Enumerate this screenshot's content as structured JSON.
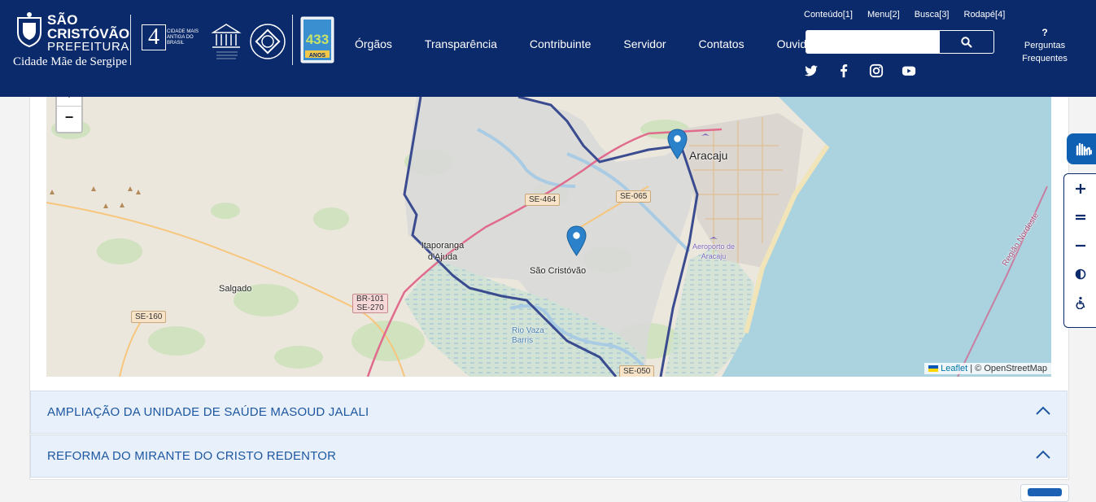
{
  "header": {
    "logo": {
      "line1": "SÃO",
      "line2": "CRISTÓVÃO",
      "line3": "PREFEITURA",
      "tagline": "Cidade Mãe de Sergipe"
    },
    "badge": {
      "number": "4",
      "text": "CIDADE MAIS ANTIGA DO BRASIL"
    },
    "anniversary": {
      "number": "433",
      "unit": "ANOS"
    },
    "nav": [
      "Órgãos",
      "Transparência",
      "Contribuinte",
      "Servidor",
      "Contatos",
      "Ouvidoria"
    ],
    "access_links": [
      "Conteúdo[1]",
      "Menu[2]",
      "Busca[3]",
      "Rodapé[4]"
    ],
    "search": {
      "placeholder": "",
      "value": ""
    },
    "social": [
      "twitter-icon",
      "facebook-icon",
      "instagram-icon",
      "youtube-icon"
    ],
    "faq": {
      "icon": "?",
      "line1": "Perguntas",
      "line2": "Frequentes"
    },
    "colors": {
      "bg": "#0b2a6b",
      "accent": "#1d57a0"
    }
  },
  "map": {
    "zoom_in": "+",
    "zoom_out": "−",
    "attribution": {
      "leaflet": "Leaflet",
      "rest": "| © OpenStreetMap"
    },
    "places": [
      "Aracaju",
      "Itaporanga d'Ajuda",
      "São Cristóvão",
      "Salgado",
      "Aeroporto de Aracaju",
      "Rio Vaza Barris",
      "Região Nordeste"
    ],
    "roads": [
      "SE-464",
      "SE-065",
      "BR-101",
      "SE-270",
      "SE-160",
      "SE-050"
    ],
    "markers": 2
  },
  "accordion": [
    {
      "title": "AMPLIAÇÃO DA UNIDADE DE SAÚDE MASOUD JALALI",
      "expanded": true
    },
    {
      "title": "REFORMA DO MIRANTE DO CRISTO REDENTOR",
      "expanded": true
    }
  ],
  "accessibility": {
    "buttons": [
      "zoom-in-icon",
      "reset-zoom-icon",
      "zoom-out-icon",
      "contrast-icon",
      "accessibility-icon"
    ]
  }
}
